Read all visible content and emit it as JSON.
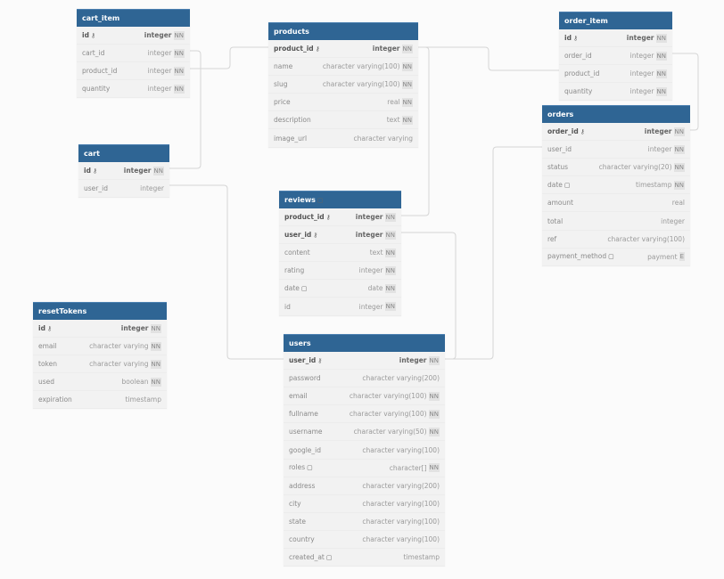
{
  "colors": {
    "header": "#2f6594",
    "body": "#f2f2f2",
    "line": "#d6d6d6"
  },
  "tables": [
    {
      "id": "cart_item",
      "name": "cart_item",
      "columns": [
        {
          "name": "id",
          "type": "integer",
          "nn": true,
          "pk": true
        },
        {
          "name": "cart_id",
          "type": "integer",
          "nn": true
        },
        {
          "name": "product_id",
          "type": "integer",
          "nn": true
        },
        {
          "name": "quantity",
          "type": "integer",
          "nn": true
        }
      ]
    },
    {
      "id": "products",
      "name": "products",
      "columns": [
        {
          "name": "product_id",
          "type": "integer",
          "nn": true,
          "pk": true
        },
        {
          "name": "name",
          "type": "character varying(100)",
          "nn": true
        },
        {
          "name": "slug",
          "type": "character varying(100)",
          "nn": true
        },
        {
          "name": "price",
          "type": "real",
          "nn": true
        },
        {
          "name": "description",
          "type": "text",
          "nn": true
        },
        {
          "name": "image_url",
          "type": "character varying"
        }
      ]
    },
    {
      "id": "order_item",
      "name": "order_item",
      "columns": [
        {
          "name": "id",
          "type": "integer",
          "nn": true,
          "pk": true
        },
        {
          "name": "order_id",
          "type": "integer",
          "nn": true
        },
        {
          "name": "product_id",
          "type": "integer",
          "nn": true
        },
        {
          "name": "quantity",
          "type": "integer",
          "nn": true
        }
      ]
    },
    {
      "id": "orders",
      "name": "orders",
      "columns": [
        {
          "name": "order_id",
          "type": "integer",
          "nn": true,
          "pk": true
        },
        {
          "name": "user_id",
          "type": "integer",
          "nn": true
        },
        {
          "name": "status",
          "type": "character varying(20)",
          "nn": true
        },
        {
          "name": "date",
          "type": "timestamp",
          "nn": true,
          "note": true
        },
        {
          "name": "amount",
          "type": "real"
        },
        {
          "name": "total",
          "type": "integer"
        },
        {
          "name": "ref",
          "type": "character varying(100)"
        },
        {
          "name": "payment_method",
          "type": "payment",
          "note": true,
          "enum": "E"
        }
      ]
    },
    {
      "id": "cart",
      "name": "cart",
      "columns": [
        {
          "name": "id",
          "type": "integer",
          "nn": true,
          "pk": true
        },
        {
          "name": "user_id",
          "type": "integer"
        }
      ]
    },
    {
      "id": "reviews",
      "name": "reviews",
      "note": true,
      "columns": [
        {
          "name": "product_id",
          "type": "integer",
          "nn": true,
          "pk": true
        },
        {
          "name": "user_id",
          "type": "integer",
          "nn": true,
          "pk": true
        },
        {
          "name": "content",
          "type": "text",
          "nn": true
        },
        {
          "name": "rating",
          "type": "integer",
          "nn": true
        },
        {
          "name": "date",
          "type": "date",
          "nn": true,
          "note": true
        },
        {
          "name": "id",
          "type": "integer",
          "nn": true
        }
      ]
    },
    {
      "id": "resetTokens",
      "name": "resetTokens",
      "columns": [
        {
          "name": "id",
          "type": "integer",
          "nn": true,
          "pk": true
        },
        {
          "name": "email",
          "type": "character varying",
          "nn": true
        },
        {
          "name": "token",
          "type": "character varying",
          "nn": true
        },
        {
          "name": "used",
          "type": "boolean",
          "nn": true
        },
        {
          "name": "expiration",
          "type": "timestamp"
        }
      ]
    },
    {
      "id": "users",
      "name": "users",
      "columns": [
        {
          "name": "user_id",
          "type": "integer",
          "nn": true,
          "pk": true
        },
        {
          "name": "password",
          "type": "character varying(200)"
        },
        {
          "name": "email",
          "type": "character varying(100)",
          "nn": true
        },
        {
          "name": "fullname",
          "type": "character varying(100)",
          "nn": true
        },
        {
          "name": "username",
          "type": "character varying(50)",
          "nn": true
        },
        {
          "name": "google_id",
          "type": "character varying(100)"
        },
        {
          "name": "roles",
          "type": "character[]",
          "nn": true,
          "note": true
        },
        {
          "name": "address",
          "type": "character varying(200)"
        },
        {
          "name": "city",
          "type": "character varying(100)"
        },
        {
          "name": "state",
          "type": "character varying(100)"
        },
        {
          "name": "country",
          "type": "character varying(100)"
        },
        {
          "name": "created_at",
          "type": "timestamp",
          "note": true
        }
      ]
    }
  ],
  "labels": {
    "nn": "NN",
    "key_icon": "⚷",
    "note_icon": "▢"
  }
}
